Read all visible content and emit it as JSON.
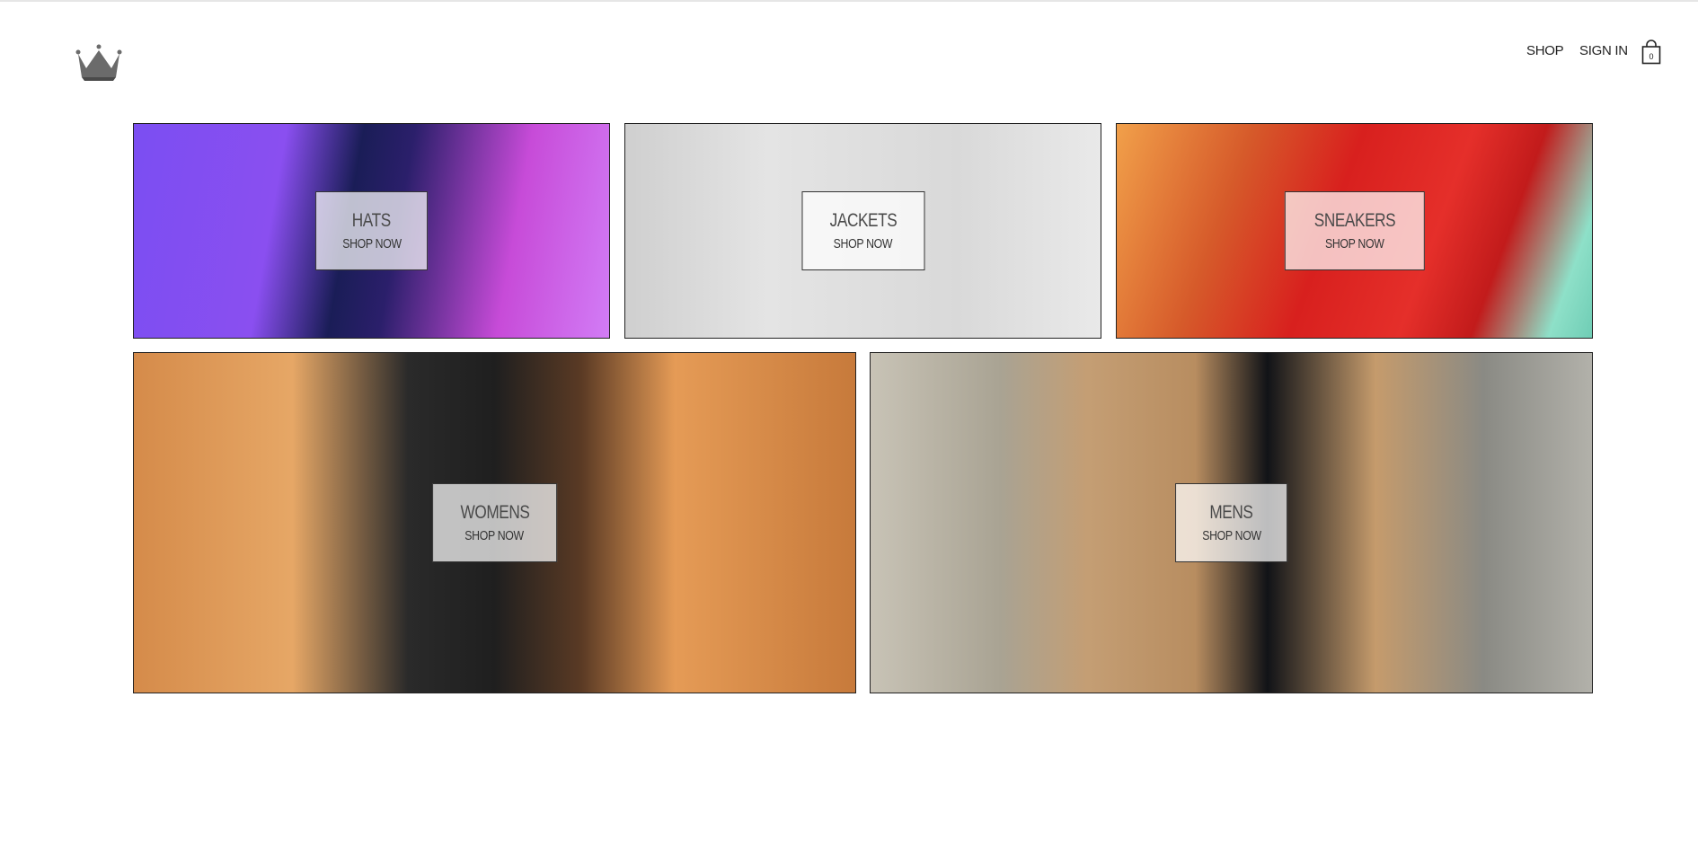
{
  "header": {
    "logo_icon": "crown-icon",
    "nav": {
      "shop_label": "SHOP",
      "signin_label": "SIGN IN"
    },
    "cart_icon": "shopping-bag-icon",
    "cart_count": "0"
  },
  "directory": {
    "tiles": [
      {
        "title": "HATS",
        "subtitle": "SHOP NOW"
      },
      {
        "title": "JACKETS",
        "subtitle": "SHOP NOW"
      },
      {
        "title": "SNEAKERS",
        "subtitle": "SHOP NOW"
      },
      {
        "title": "WOMENS",
        "subtitle": "SHOP NOW"
      },
      {
        "title": "MENS",
        "subtitle": "SHOP NOW"
      }
    ]
  }
}
